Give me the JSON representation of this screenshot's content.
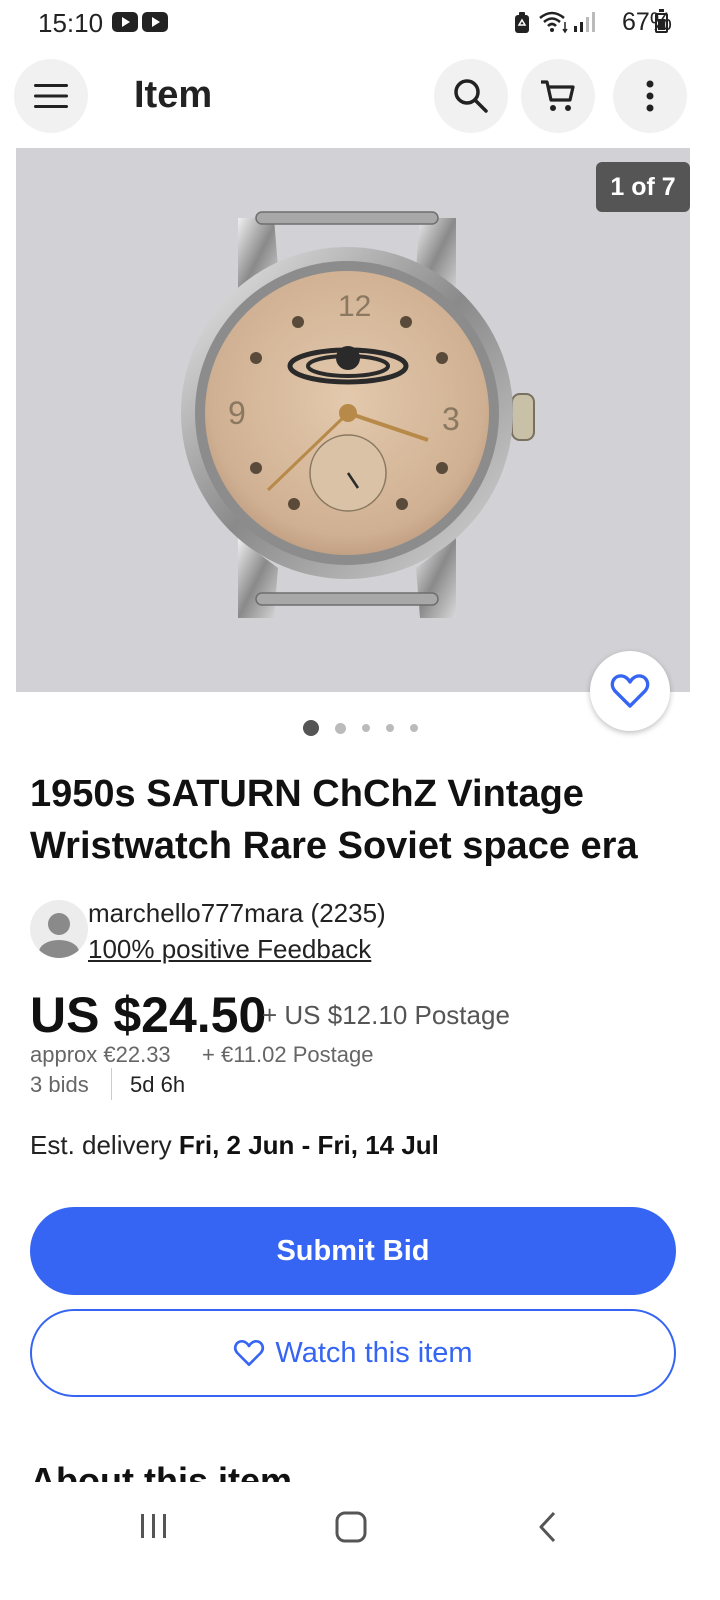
{
  "status_bar": {
    "time": "15:10",
    "battery": "67%",
    "icons": [
      "youtube-icon",
      "youtube-icon",
      "recycle-notification-icon",
      "wifi-icon",
      "signal-icon",
      "battery-icon"
    ]
  },
  "header": {
    "title": "Item",
    "icons": [
      "menu-icon",
      "search-icon",
      "cart-icon",
      "more-icon"
    ]
  },
  "gallery": {
    "counter": "1 of 7",
    "image_subject": "Vintage SATURN wristwatch, cream dial",
    "dots_count": 5,
    "active_dot": 1
  },
  "item": {
    "title": "1950s SATURN ChChZ Vintage Wristwatch Rare Soviet space era"
  },
  "seller": {
    "name": "marchello777mara (2235)",
    "feedback": "100% positive Feedback"
  },
  "pricing": {
    "price": "US $24.50",
    "postage": "+ US $12.10 Postage",
    "approx": "approx €22.33",
    "approx_postage": "+ €11.02 Postage",
    "bids": "3 bids",
    "time_left": "5d 6h"
  },
  "delivery": {
    "label": "Est. delivery",
    "dates": "Fri, 2 Jun - Fri, 14 Jul"
  },
  "actions": {
    "submit_bid": "Submit Bid",
    "watch": "Watch this item"
  },
  "section": {
    "about": "About this item"
  },
  "colors": {
    "primary": "#3665f3",
    "text": "#111111",
    "muted": "#666666"
  }
}
